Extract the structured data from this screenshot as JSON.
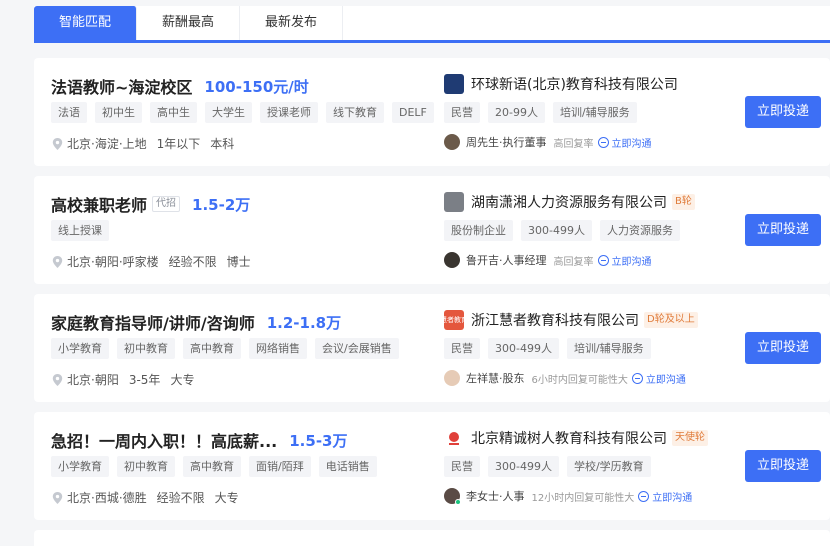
{
  "tabs": [
    "智能匹配",
    "薪酬最高",
    "最新发布"
  ],
  "apply_label": "立即投递",
  "chat_label": "立即沟通",
  "jobs": [
    {
      "title": "法语教师~海淀校区",
      "badge": "",
      "salary": "100-150元/时",
      "tags": [
        "法语",
        "初中生",
        "高中生",
        "大学生",
        "授课老师",
        "线下教育",
        "DELF"
      ],
      "location": "北京·海淀·上地",
      "experience": "1年以下",
      "education": "本科",
      "company": {
        "name": "环球新语(北京)教育科技有限公司",
        "funding": "",
        "logo_color": "#1f3b73",
        "logo_text": ""
      },
      "company_tags": [
        "民营",
        "20-99人",
        "培训/辅导服务"
      ],
      "recruiter": "周先生·执行董事",
      "reply_hint": "高回复率"
    },
    {
      "title": "高校兼职老师",
      "badge": "代招",
      "salary": "1.5-2万",
      "tags": [
        "线上授课"
      ],
      "location": "北京·朝阳·呼家楼",
      "experience": "经验不限",
      "education": "博士",
      "company": {
        "name": "湖南潇湘人力资源服务有限公司",
        "funding": "B轮",
        "logo_color": "#7b7f86",
        "logo_text": ""
      },
      "company_tags": [
        "股份制企业",
        "300-499人",
        "人力资源服务"
      ],
      "recruiter": "鲁开吉·人事经理",
      "reply_hint": "高回复率"
    },
    {
      "title": "家庭教育指导师/讲师/咨询师",
      "badge": "",
      "salary": "1.2-1.8万",
      "tags": [
        "小学教育",
        "初中教育",
        "高中教育",
        "网络销售",
        "会议/会展销售"
      ],
      "location": "北京·朝阳",
      "experience": "3-5年",
      "education": "大专",
      "company": {
        "name": "浙江慧者教育科技有限公司",
        "funding": "D轮及以上",
        "logo_color": "#e4573d",
        "logo_text": "慧者教育"
      },
      "company_tags": [
        "民营",
        "300-499人",
        "培训/辅导服务"
      ],
      "recruiter": "左祥慧·股东",
      "reply_hint": "6小时内回复可能性大"
    },
    {
      "title": "急招！一周内入职！！高底薪...",
      "badge": "",
      "salary": "1.5-3万",
      "tags": [
        "小学教育",
        "初中教育",
        "高中教育",
        "面销/陌拜",
        "电话销售"
      ],
      "location": "北京·西城·德胜",
      "experience": "经验不限",
      "education": "大专",
      "company": {
        "name": "北京精诚树人教育科技有限公司",
        "funding": "天使轮",
        "logo_color": "#e0403a",
        "logo_text": ""
      },
      "company_tags": [
        "民营",
        "300-499人",
        "学校/学历教育"
      ],
      "recruiter": "李女士·人事",
      "reply_hint": "12小时内回复可能性大"
    }
  ]
}
